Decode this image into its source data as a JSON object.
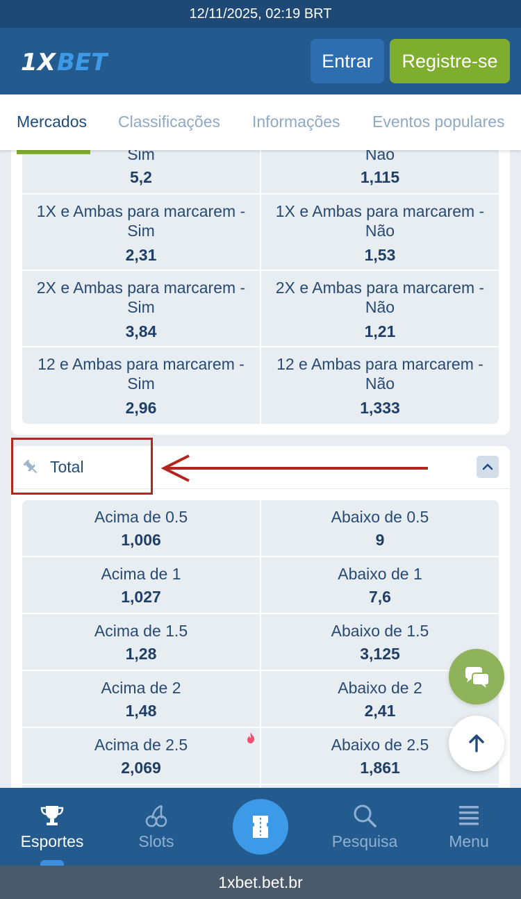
{
  "status_bar": {
    "datetime": "12/11/2025, 02:19 BRT"
  },
  "header": {
    "brand": "1XBET",
    "login_label": "Entrar",
    "register_label": "Registre-se"
  },
  "tabs": [
    {
      "label": "Mercados",
      "active": true
    },
    {
      "label": "Classificações",
      "active": false
    },
    {
      "label": "Informações",
      "active": false
    },
    {
      "label": "Eventos populares",
      "active": false
    }
  ],
  "market_btts": {
    "rows": [
      {
        "left": {
          "name": "Sim",
          "odd": "5,2"
        },
        "right": {
          "name": "Não",
          "odd": "1,115"
        }
      },
      {
        "left": {
          "name_line1": "1X e Ambas para marcarem -",
          "name_line2": "Sim",
          "odd": "2,31"
        },
        "right": {
          "name_line1": "1X e Ambas para marcarem -",
          "name_line2": "Não",
          "odd": "1,53"
        }
      },
      {
        "left": {
          "name_line1": "2X e Ambas para marcarem -",
          "name_line2": "Sim",
          "odd": "3,84"
        },
        "right": {
          "name_line1": "2X e Ambas para marcarem -",
          "name_line2": "Não",
          "odd": "1,21"
        }
      },
      {
        "left": {
          "name_line1": "12 e Ambas para marcarem -",
          "name_line2": "Sim",
          "odd": "2,96"
        },
        "right": {
          "name_line1": "12 e Ambas para marcarem -",
          "name_line2": "Não",
          "odd": "1,333"
        }
      }
    ]
  },
  "market_total": {
    "title": "Total",
    "rows": [
      {
        "left": {
          "name": "Acima de 0.5",
          "odd": "1,006"
        },
        "right": {
          "name": "Abaixo de 0.5",
          "odd": "9"
        }
      },
      {
        "left": {
          "name": "Acima de 1",
          "odd": "1,027"
        },
        "right": {
          "name": "Abaixo de 1",
          "odd": "7,6"
        }
      },
      {
        "left": {
          "name": "Acima de 1.5",
          "odd": "1,28"
        },
        "right": {
          "name": "Abaixo de 1.5",
          "odd": "3,125"
        }
      },
      {
        "left": {
          "name": "Acima de 2",
          "odd": "1,48"
        },
        "right": {
          "name": "Abaixo de 2",
          "odd": "2,41"
        }
      },
      {
        "left": {
          "name": "Acima de 2.5",
          "odd": "2,069",
          "hot": true
        },
        "right": {
          "name": "Abaixo de 2.5",
          "odd": "1,861",
          "hot": true
        }
      }
    ]
  },
  "bottom_nav": [
    {
      "label": "Esportes",
      "icon": "trophy-icon",
      "active": true
    },
    {
      "label": "Slots",
      "icon": "cherry-icon",
      "active": false
    },
    {
      "label": "",
      "icon": "coupon-icon",
      "active": false
    },
    {
      "label": "Pesquisa",
      "icon": "search-icon",
      "active": false
    },
    {
      "label": "Menu",
      "icon": "menu-icon",
      "active": false
    }
  ],
  "url_bar": {
    "url": "1xbet.bet.br"
  },
  "colors": {
    "header": "#235b8f",
    "accent_green": "#7fae2f",
    "cell_bg": "#e8edf2",
    "annotation_red": "#b3261e"
  }
}
